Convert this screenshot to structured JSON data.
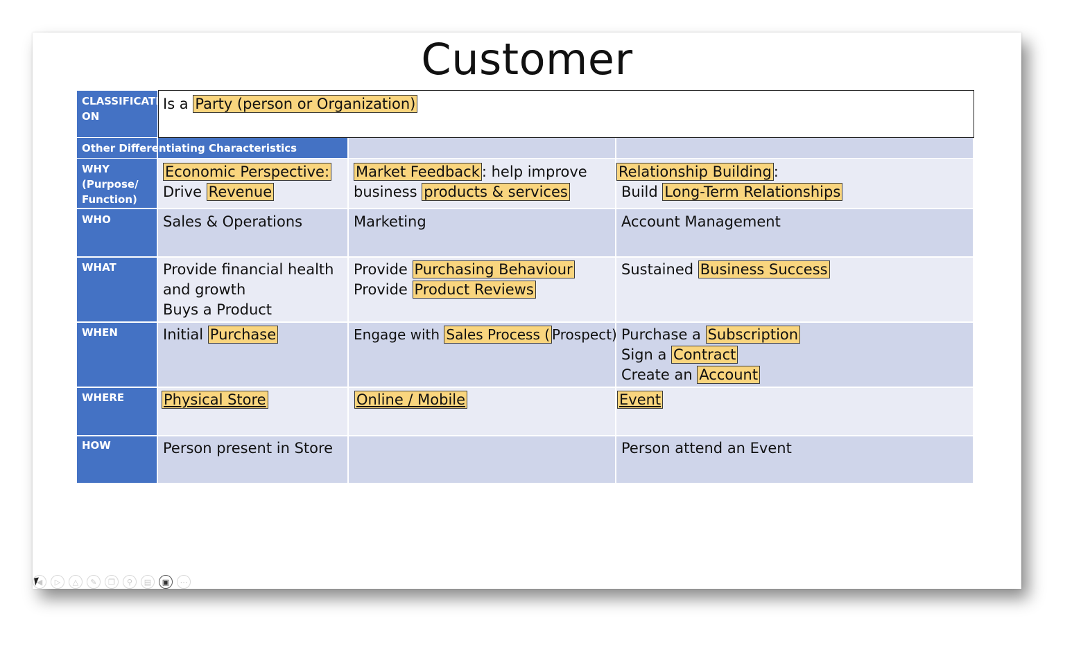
{
  "title": "Customer",
  "colors": {
    "label_blue": "#4472c4",
    "row_light": "#e9ebf5",
    "row_dark": "#cfd5ea",
    "highlight": "#f9d57e"
  },
  "classification": {
    "label_line1": "CLASSIFICATI",
    "label_line2": "ON",
    "text_prefix": "Is a ",
    "text_highlight": "Party (person or Organization)"
  },
  "section_header": "Other Differentiating Characteristics",
  "rows": {
    "why": {
      "label": [
        "WHY",
        "(Purpose/",
        "Function)"
      ],
      "col1": {
        "hl1": "Economic Perspective:",
        "prefix2": "Drive ",
        "hl2": "Revenue"
      },
      "col2": {
        "hl1": "Market Feedback",
        "suffix1": ": help improve",
        "prefix2": "business ",
        "hl2": "products & services"
      },
      "col3": {
        "hl1": "Relationship Building",
        "suffix1": ":",
        "prefix2": "Build ",
        "hl2": "Long-Term Relationships"
      }
    },
    "who": {
      "label": "WHO",
      "col1": "Sales & Operations",
      "col2": "Marketing",
      "col3": "Account Management"
    },
    "what": {
      "label": "WHAT",
      "col1": [
        "Provide financial health",
        "and growth",
        "Buys a Product"
      ],
      "col2": {
        "prefix1": "Provide ",
        "hl1": "Purchasing Behaviour",
        "prefix2": "Provide ",
        "hl2": "Product Reviews"
      },
      "col3": {
        "prefix1": "Sustained ",
        "hl1": "Business Success"
      }
    },
    "when": {
      "label": "WHEN",
      "col1": {
        "prefix": "Initial ",
        "hl": "Purchase"
      },
      "col2": {
        "prefix": "Engage with ",
        "hl": "Sales Process (",
        "suffix": "Prospect)"
      },
      "col3": {
        "prefix1": "Purchase a ",
        "hl1": "Subscription",
        "prefix2": "Sign a ",
        "hl2": "Contract",
        "prefix3": "Create an ",
        "hl3": "Account"
      }
    },
    "where": {
      "label": "WHERE",
      "col1": "Physical Store",
      "col2": "Online / Mobile",
      "col3": "Event"
    },
    "how": {
      "label": "HOW",
      "col1": "Person present in Store",
      "col2": "",
      "col3": "Person attend an Event"
    }
  },
  "toolbar": {
    "buttons": [
      "back-icon",
      "play-icon",
      "up-icon",
      "pen-icon",
      "copy-icon",
      "zoom-icon",
      "subtitles-icon",
      "video-icon",
      "more-icon"
    ]
  }
}
